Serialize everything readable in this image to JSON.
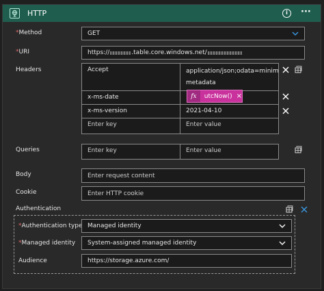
{
  "header": {
    "title": "HTTP",
    "info_icon": "info-icon",
    "more_icon": "ellipsis-icon",
    "color": "#1f5e4e"
  },
  "required_marker": "*",
  "fields": {
    "method": {
      "label": "Method",
      "value": "GET"
    },
    "uri": {
      "label": "URI",
      "value_prefix": "https://",
      "value_mid": ".table.core.windows.net/"
    },
    "headers": {
      "label": "Headers",
      "rows": [
        {
          "key": "Accept",
          "value": "application/json;odata=minimal",
          "value2": "metadata"
        },
        {
          "key": "x-ms-date",
          "token": {
            "fx": "fx",
            "label": "utcNow()",
            "remove": "×"
          }
        },
        {
          "key": "x-ms-version",
          "value": "2021-04-10"
        },
        {
          "key_placeholder": "Enter key",
          "value_placeholder": "Enter value"
        }
      ]
    },
    "queries": {
      "label": "Queries",
      "key_placeholder": "Enter key",
      "value_placeholder": "Enter value"
    },
    "body": {
      "label": "Body",
      "placeholder": "Enter request content"
    },
    "cookie": {
      "label": "Cookie",
      "placeholder": "Enter HTTP cookie"
    },
    "authentication": {
      "label": "Authentication",
      "type": {
        "label": "Authentication type",
        "value": "Managed identity"
      },
      "identity": {
        "label": "Managed identity",
        "value": "System-assigned managed identity"
      },
      "audience": {
        "label": "Audience",
        "value": "https://storage.azure.com/"
      }
    }
  },
  "colors": {
    "accent": "#3a96dd",
    "required": "#e06c6c",
    "token": "#c9329c"
  }
}
